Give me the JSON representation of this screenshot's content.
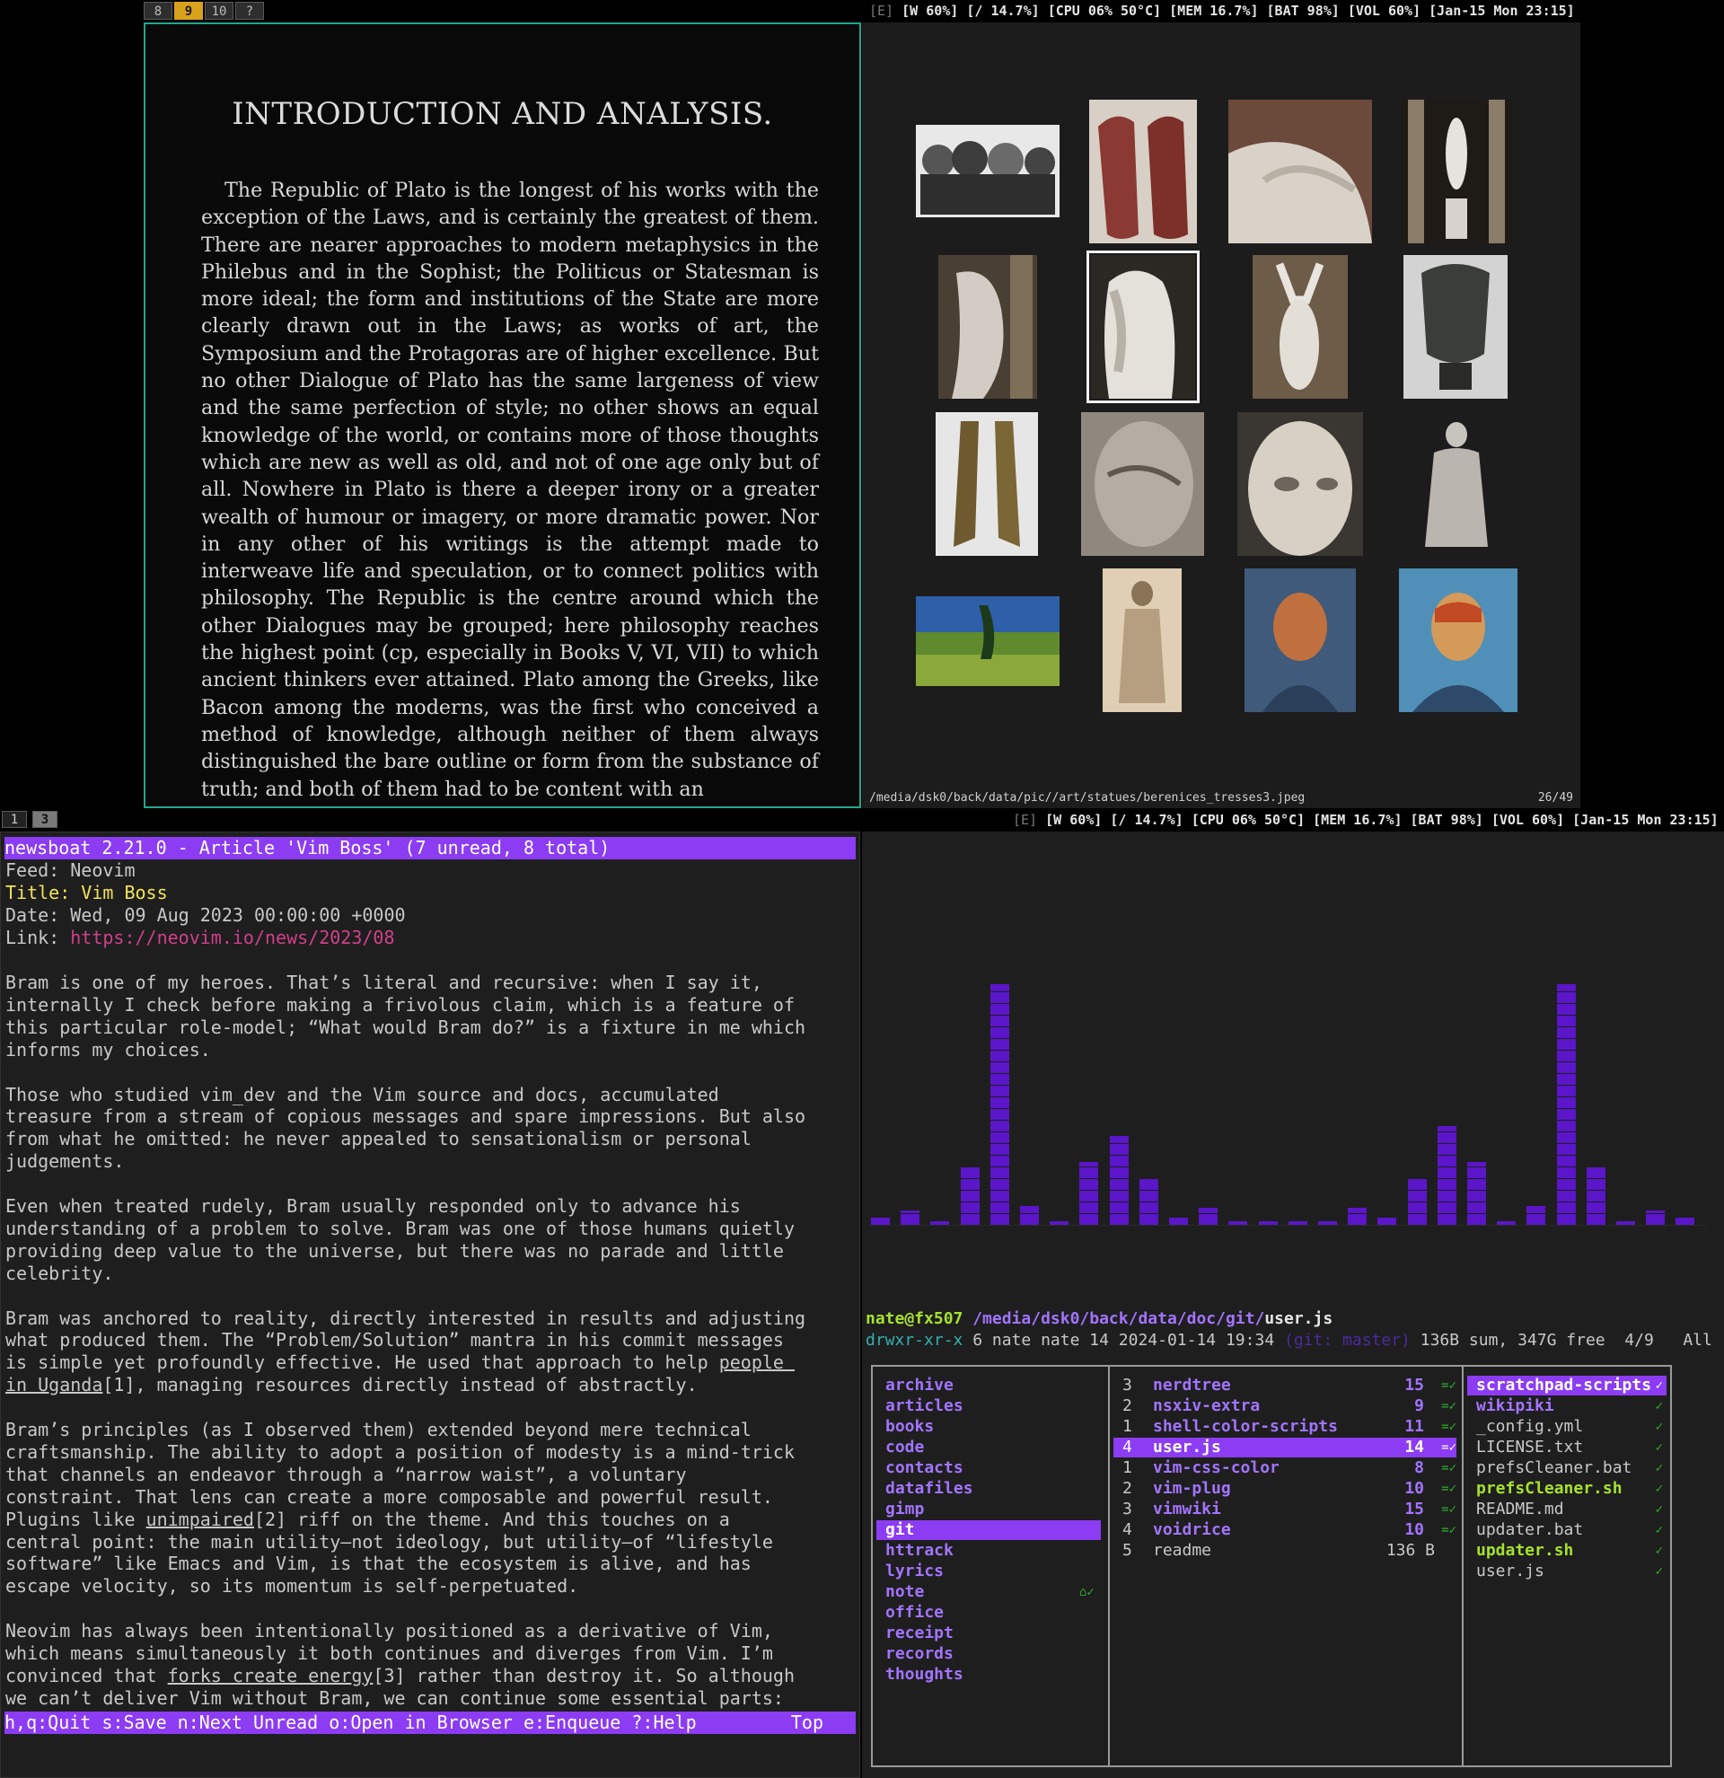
{
  "top_monitor": {
    "workspaces": [
      {
        "label": "8",
        "active": false
      },
      {
        "label": "9",
        "active": true
      },
      {
        "label": "10",
        "active": false
      },
      {
        "label": "?",
        "active": false
      }
    ],
    "status": {
      "editor": "[E]",
      "wifi": "[W 60%]",
      "disk": "[/ 14.7%]",
      "cpu": "[CPU 06% 50°C]",
      "mem": "[MEM 16.7%]",
      "battery": "[BAT 98%]",
      "volume": "[VOL 60%]",
      "datetime": "[Jan-15 Mon 23:15]"
    },
    "document": {
      "title": "INTRODUCTION AND ANALYSIS.",
      "body": "The Republic of Plato is the longest of his works with the exception of the Laws, and is certainly the greatest of them. There are nearer approaches to modern metaphysics in the Philebus and in the Sophist; the Politicus or Statesman is more ideal; the form and institutions of the State are more clearly drawn out in the Laws; as works of art, the Symposium and the Protagoras are of higher excellence. But no other Dialogue of Plato has the same largeness of view and the same perfection of style; no other shows an equal knowledge of the world, or contains more of those thoughts which are new as well as old, and not of one age only but of all. Nowhere in Plato is there a deeper irony or a greater wealth of humour or imagery, or more dramatic power. Nor in any other of his writings is the attempt made to interweave life and speculation, or to connect politics with philosophy. The Republic is the centre around which the other Dialogues may be grouped; here philosophy reaches the highest point (cp, especially in Books V, VI, VII) to which ancient thinkers ever attained. Plato among the Greeks, like Bacon among the moderns, was the first who conceived a method of knowledge, although neither of them always distinguished the bare outline or form from the substance of truth; and both of them had to be content with an"
    },
    "image_viewer": {
      "path": "/media/dsk0/back/data/pic//art/statues/berenices_tresses3.jpeg",
      "count": "26/49"
    }
  },
  "bottom_monitor": {
    "workspaces": [
      {
        "label": "1",
        "active": false
      },
      {
        "label": "3",
        "active": true
      }
    ],
    "status": {
      "editor": "[E]",
      "wifi": "[W 60%]",
      "disk": "[/ 14.7%]",
      "cpu": "[CPU 06% 50°C]",
      "mem": "[MEM 16.7%]",
      "battery": "[BAT 98%]",
      "volume": "[VOL 60%]",
      "datetime": "[Jan-15 Mon 23:15]"
    },
    "newsboat": {
      "header": "newsboat 2.21.0 - Article 'Vim Boss' (7 unread, 8 total)",
      "feed_label": "Feed: ",
      "feed": "Neovim",
      "title_label": "Title: ",
      "title": "Vim Boss",
      "date_label": "Date: ",
      "date": "Wed, 09 Aug 2023 00:00:00 +0000",
      "link_label": "Link: ",
      "link": "https://neovim.io/news/2023/08",
      "paragraphs": [
        [
          "Bram is one of my heroes. That’s literal and recursive: when I say it,",
          "internally I check before making a frivolous claim, which is a feature of",
          "this particular role-model; “What would Bram do?” is a fixture in me which",
          "informs my choices."
        ],
        [
          "Those who studied vim_dev and the Vim source and docs, accumulated",
          "treasure from a stream of copious messages and spare impressions. But also",
          "from what he omitted: he never appealed to sensationalism or personal",
          "judgements."
        ],
        [
          "Even when treated rudely, Bram usually responded only to advance his",
          "understanding of a problem to solve. Bram was one of those humans quietly",
          "providing deep value to the universe, but there was no parade and little",
          "celebrity."
        ],
        [
          "Bram was anchored to reality, directly interested in results and adjusting",
          "what produced them. The “Problem/Solution” mantra in his commit messages",
          "is simple yet profoundly effective. He used that approach to help people ",
          "in Uganda[1], managing resources directly instead of abstractly."
        ],
        [
          "Bram’s principles (as I observed them) extended beyond mere technical",
          "craftsmanship. The ability to adopt a position of modesty is a mind-trick",
          "that channels an endeavor through a “narrow waist”, a voluntary",
          "constraint. That lens can create a more composable and powerful result.",
          "Plugins like unimpaired[2] riff on the theme. And this touches on a",
          "central point: the main utility—not ideology, but utility—of “lifestyle",
          "software” like Emacs and Vim, is that the ecosystem is alive, and has",
          "escape velocity, so its momentum is self-perpetuated."
        ],
        [
          "Neovim has always been intentionally positioned as a derivative of Vim,",
          "which means simultaneously it both continues and diverges from Vim. I’m",
          "convinced that forks create energy[3] rather than destroy it. So although",
          "we can’t deliver Vim without Bram, we can continue some essential parts:"
        ]
      ],
      "footer": "h,q:Quit s:Save n:Next Unread o:Open in Browser e:Enqueue ?:Help",
      "footer_right": "Top"
    },
    "visualizer": {
      "levels": [
        0.03,
        0.06,
        0.01,
        0.24,
        1.0,
        0.08,
        0.01,
        0.26,
        0.37,
        0.19,
        0.03,
        0.07,
        0.01,
        0.01,
        0.01,
        0.01,
        0.07,
        0.03,
        0.19,
        0.41,
        0.26,
        0.01,
        0.08,
        1.0,
        0.24,
        0.01,
        0.06,
        0.03
      ]
    },
    "lf": {
      "user_host": "nate@fx507",
      "dir": " /media/dsk0/back/data/doc/git/",
      "file": "user.js",
      "perms": "drwxr-xr-x",
      "meta": " 6 nate nate 14 2024-01-14 19:34 ",
      "git": "(git: master)",
      "summary": " 136B sum, 347G free  4/9   All",
      "parent": [
        "archive",
        "articles",
        "books",
        "code",
        "contacts",
        "datafiles",
        "gimp",
        "git",
        "httrack",
        "lyrics",
        "note",
        "office",
        "receipt",
        "records",
        "thoughts"
      ],
      "parent_selected": 7,
      "note_mark": "⌂✓",
      "current": [
        {
          "n": "3",
          "name": "nerdtree",
          "count": "15",
          "mark": "=✓"
        },
        {
          "n": "2",
          "name": "nsxiv-extra",
          "count": "9",
          "mark": "=✓"
        },
        {
          "n": "1",
          "name": "shell-color-scripts",
          "count": "11",
          "mark": "=✓"
        },
        {
          "n": "4",
          "name": "user.js",
          "count": "14",
          "mark": "=✓"
        },
        {
          "n": "1",
          "name": "vim-css-color",
          "count": "8",
          "mark": "=✓"
        },
        {
          "n": "2",
          "name": "vim-plug",
          "count": "10",
          "mark": "=✓"
        },
        {
          "n": "3",
          "name": "vimwiki",
          "count": "15",
          "mark": "=✓"
        },
        {
          "n": "4",
          "name": "voidrice",
          "count": "10",
          "mark": "=✓"
        },
        {
          "n": "5",
          "name": "readme",
          "count": "136 B",
          "mark": ""
        }
      ],
      "current_selected": 3,
      "preview": [
        {
          "name": "scratchpad-scripts",
          "kind": "dir"
        },
        {
          "name": "wikipiki",
          "kind": "dir"
        },
        {
          "name": "_config.yml",
          "kind": "file"
        },
        {
          "name": "LICENSE.txt",
          "kind": "file"
        },
        {
          "name": "prefsCleaner.bat",
          "kind": "file"
        },
        {
          "name": "prefsCleaner.sh",
          "kind": "exec"
        },
        {
          "name": "README.md",
          "kind": "file"
        },
        {
          "name": "updater.bat",
          "kind": "file"
        },
        {
          "name": "updater.sh",
          "kind": "exec"
        },
        {
          "name": "user.js",
          "kind": "file"
        }
      ],
      "preview_mark": "✓"
    }
  },
  "colors": {
    "accent": "#8c3cf2",
    "active_ws": "#d9a21c",
    "zathura_border": "#1fa88d",
    "link": "#d0408a",
    "title": "#f2e35a",
    "user_host": "#a6e22e",
    "dir": "#a274ff",
    "git_branch": "#4b2aa0",
    "perms": "#34b0b0",
    "mark": "#2fae2f"
  }
}
